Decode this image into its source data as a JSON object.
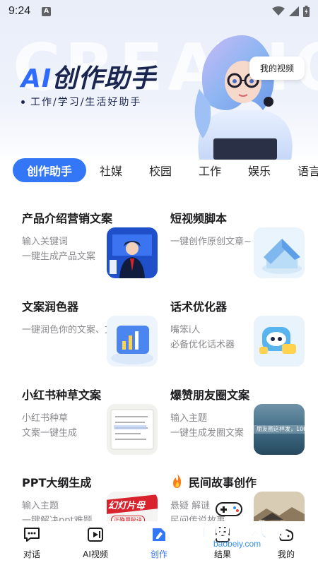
{
  "status_bar": {
    "time": "9:24",
    "notification_glyph": "A"
  },
  "hero": {
    "title_ai": "AI",
    "title_rest": "创作助手",
    "subtitle": "工作/学习/生活好助手",
    "watermark": "CREATION",
    "my_video_button": "我的视频"
  },
  "tabs": [
    {
      "label": "创作助手",
      "active": true
    },
    {
      "label": "社媒",
      "active": false
    },
    {
      "label": "校园",
      "active": false
    },
    {
      "label": "工作",
      "active": false
    },
    {
      "label": "娱乐",
      "active": false
    },
    {
      "label": "语言",
      "active": false
    }
  ],
  "cards": [
    {
      "title": "产品介绍营销文案",
      "desc1": "输入关键词",
      "desc2": "一键生成产品文案"
    },
    {
      "title": "短视频脚本",
      "desc1": "一键创作原创文章~",
      "desc2": ""
    },
    {
      "title": "文案润色器",
      "desc1": "一键润色你的文案、文章",
      "desc2": ""
    },
    {
      "title": "话术优化器",
      "desc1": "嘴笨i人",
      "desc2": "必备优化话术器"
    },
    {
      "title": "小红书种草文案",
      "desc1": "小红书种草",
      "desc2": "文案一键生成"
    },
    {
      "title": "爆赞朋友圈文案",
      "desc1": "输入主题",
      "desc2": "一键生成发圈文案"
    },
    {
      "title": "PPT大纲生成",
      "desc1": "输入主题",
      "desc2": "一键解决ppt难题"
    },
    {
      "title": "民间故事创作",
      "desc1": "悬疑 解谜",
      "desc2": "民间传说故事"
    }
  ],
  "card_images": {
    "moments_overlay": "朋友圈这样发，100",
    "ppt_banner": "幻灯片母",
    "ppt_sub": "正确用秘诀"
  },
  "bottom_nav": [
    {
      "label": "对话",
      "icon": "chat-icon",
      "active": false
    },
    {
      "label": "AI视频",
      "icon": "video-icon",
      "active": false
    },
    {
      "label": "创作",
      "icon": "create-icon",
      "active": true
    },
    {
      "label": "结果",
      "icon": "result-icon",
      "active": false
    },
    {
      "label": "我的",
      "icon": "profile-icon",
      "active": false
    }
  ],
  "site_watermark": {
    "text": "宝贝游戏网",
    "url": "baobeiy.com"
  },
  "colors": {
    "accent": "#3477f6",
    "title_dark": "#1b2650",
    "desc_gray": "#8a8a8e"
  }
}
